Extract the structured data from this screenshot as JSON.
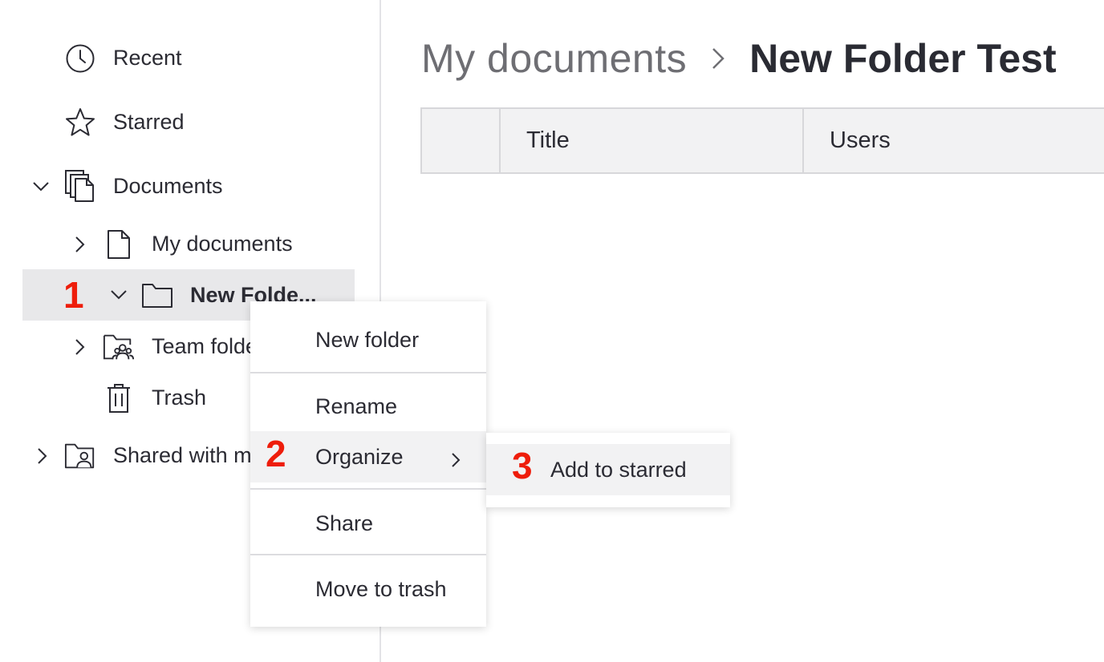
{
  "sidebar": {
    "items": [
      {
        "label": "Recent",
        "icon": "clock-icon"
      },
      {
        "label": "Starred",
        "icon": "star-icon"
      },
      {
        "label": "Documents",
        "icon": "documents-icon"
      },
      {
        "label": "My documents",
        "icon": "file-icon"
      },
      {
        "label": "New Folde...",
        "icon": "folder-icon"
      },
      {
        "label": "Team folders",
        "icon": "team-folder-icon"
      },
      {
        "label": "Trash",
        "icon": "trash-icon"
      },
      {
        "label": "Shared with me",
        "icon": "shared-folder-icon"
      }
    ]
  },
  "breadcrumb": {
    "parent": "My documents",
    "current": "New Folder Test"
  },
  "table": {
    "columns": [
      "",
      "Title",
      "Users"
    ]
  },
  "context_menu": {
    "items": [
      "New folder",
      "Rename",
      "Organize",
      "Share",
      "Move to trash"
    ]
  },
  "submenu": {
    "items": [
      "Add to starred"
    ]
  },
  "step_markers": [
    "1",
    "2",
    "3"
  ],
  "colors": {
    "accent_marker": "#ee1d0b",
    "selected_row": "#e8e8ea",
    "text": "#2b2b33"
  }
}
